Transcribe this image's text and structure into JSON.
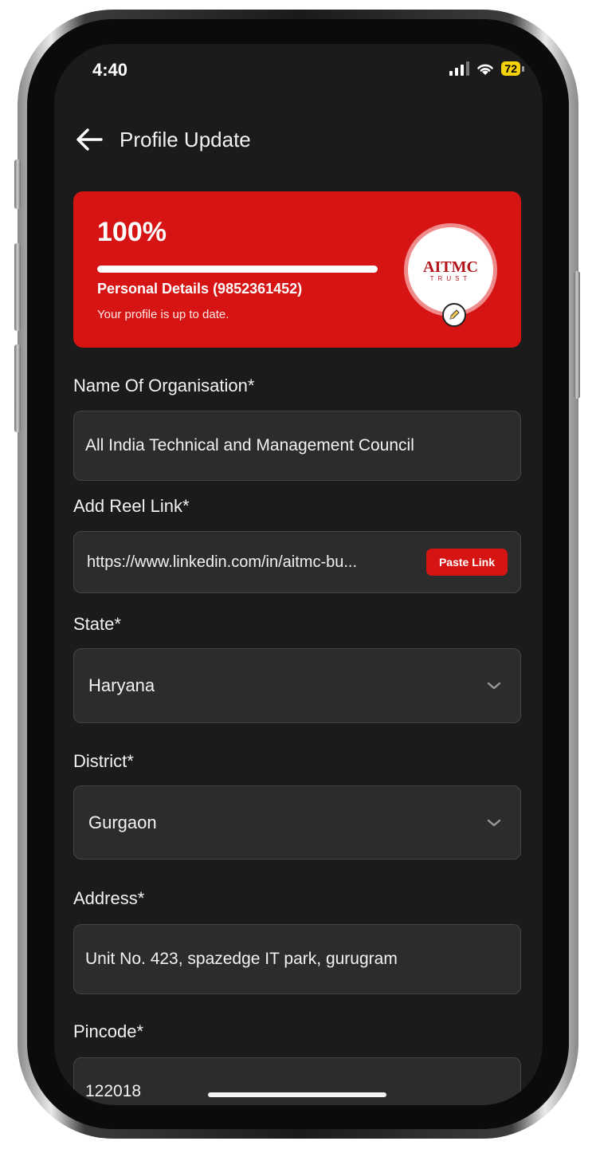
{
  "status_bar": {
    "time": "4:40",
    "battery": "72"
  },
  "header": {
    "title": "Profile Update"
  },
  "profile_card": {
    "percent_label": "100%",
    "progress_fraction": 1.0,
    "subtitle": "Personal Details (9852361452)",
    "note": "Your profile is up to date.",
    "logo_text": "AITMC",
    "logo_subtext": "TRUST"
  },
  "form": {
    "organisation": {
      "label": "Name Of Organisation*",
      "value": "All India Technical and Management Council"
    },
    "reel_link": {
      "label": "Add Reel Link*",
      "value": "https://www.linkedin.com/in/aitmc-bu...",
      "button": "Paste Link"
    },
    "state": {
      "label": "State*",
      "value": "Haryana"
    },
    "district": {
      "label": "District*",
      "value": "Gurgaon"
    },
    "address": {
      "label": "Address*",
      "value": "Unit No. 423, spazedge IT park, gurugram"
    },
    "pincode": {
      "label": "Pincode*",
      "value": "122018"
    }
  },
  "colors": {
    "accent": "#d61414",
    "background": "#1b1b1b",
    "field": "#2c2c2c"
  }
}
